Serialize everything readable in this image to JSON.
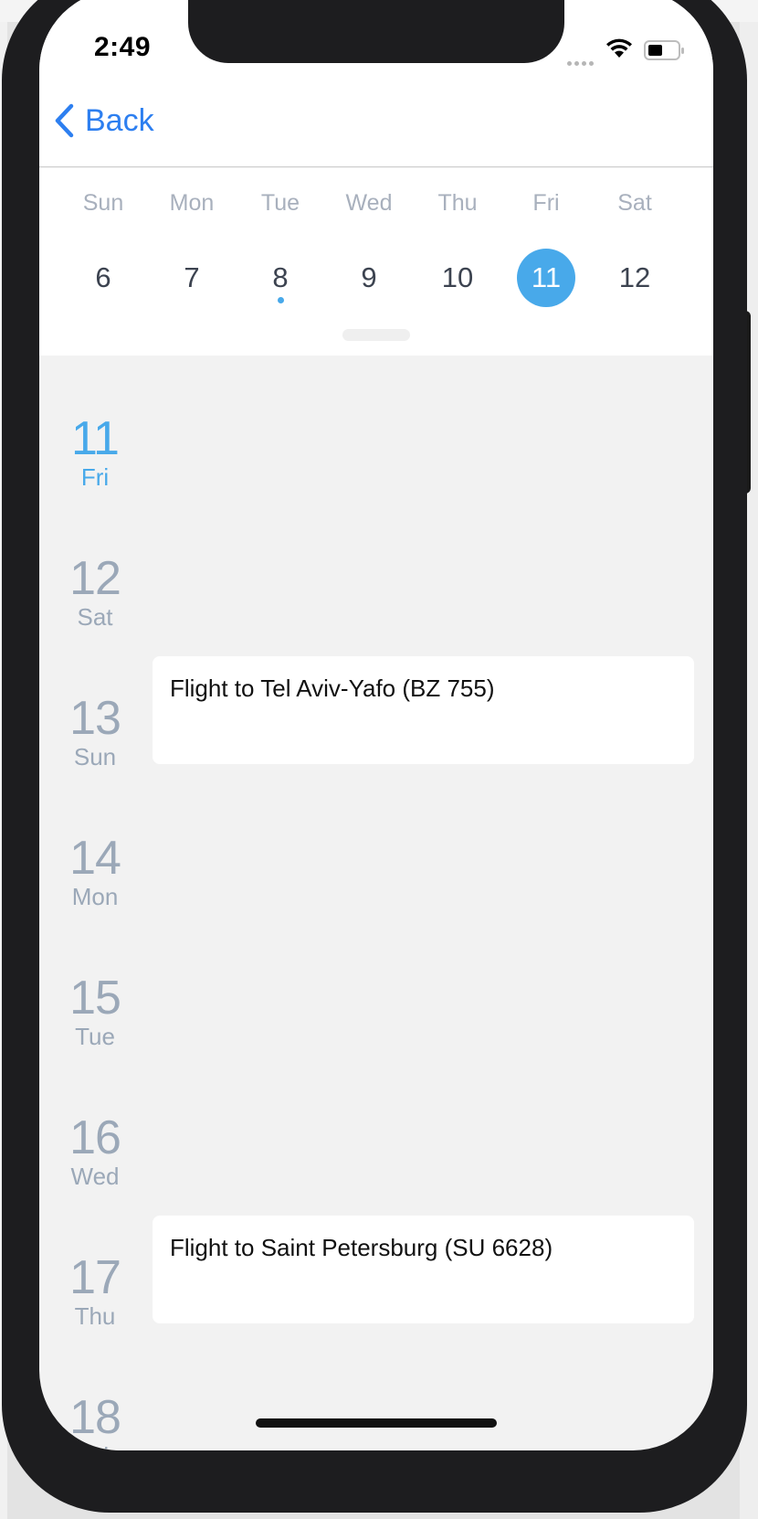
{
  "status_bar": {
    "time": "2:49"
  },
  "nav": {
    "back_label": "Back"
  },
  "week": {
    "days": [
      {
        "name": "Sun",
        "num": "6",
        "selected": false,
        "has_event": false
      },
      {
        "name": "Mon",
        "num": "7",
        "selected": false,
        "has_event": false
      },
      {
        "name": "Tue",
        "num": "8",
        "selected": false,
        "has_event": true
      },
      {
        "name": "Wed",
        "num": "9",
        "selected": false,
        "has_event": false
      },
      {
        "name": "Thu",
        "num": "10",
        "selected": false,
        "has_event": false
      },
      {
        "name": "Fri",
        "num": "11",
        "selected": true,
        "has_event": false
      },
      {
        "name": "Sat",
        "num": "12",
        "selected": false,
        "has_event": false
      }
    ]
  },
  "agenda": [
    {
      "num": "11",
      "day": "Fri",
      "today": true,
      "event": ""
    },
    {
      "num": "12",
      "day": "Sat",
      "today": false,
      "event": ""
    },
    {
      "num": "13",
      "day": "Sun",
      "today": false,
      "event": "Flight to Tel Aviv-Yafo (BZ 755)"
    },
    {
      "num": "14",
      "day": "Mon",
      "today": false,
      "event": ""
    },
    {
      "num": "15",
      "day": "Tue",
      "today": false,
      "event": ""
    },
    {
      "num": "16",
      "day": "Wed",
      "today": false,
      "event": ""
    },
    {
      "num": "17",
      "day": "Thu",
      "today": false,
      "event": "Flight to Saint Petersburg (SU 6628)"
    },
    {
      "num": "18",
      "day": "Fri",
      "today": false,
      "event": ""
    }
  ],
  "colors": {
    "accent": "#48a9ea",
    "link": "#2d7ff0",
    "muted_text": "#9ba8b8",
    "list_background": "#f2f2f2"
  }
}
